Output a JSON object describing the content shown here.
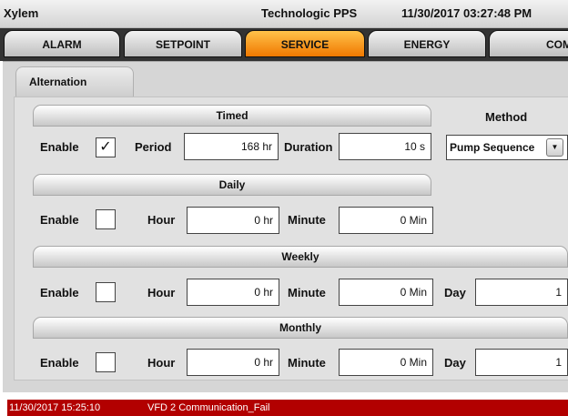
{
  "titlebar": {
    "brand": "Xylem",
    "app_name": "Technologic PPS",
    "datetime": "11/30/2017 03:27:48 PM"
  },
  "tabs": [
    {
      "label": "ALARM",
      "active": false
    },
    {
      "label": "SETPOINT",
      "active": false
    },
    {
      "label": "SERVICE",
      "active": true
    },
    {
      "label": "ENERGY",
      "active": false
    },
    {
      "label": "COM",
      "active": false
    }
  ],
  "subtab": {
    "label": "Alternation"
  },
  "timed": {
    "title": "Timed",
    "enable_label": "Enable",
    "enabled": true,
    "period_label": "Period",
    "period_value": "168 hr",
    "duration_label": "Duration",
    "duration_value": "10 s"
  },
  "method": {
    "title": "Method",
    "value": "Pump Sequence"
  },
  "daily": {
    "title": "Daily",
    "enable_label": "Enable",
    "enabled": false,
    "hour_label": "Hour",
    "hour_value": "0 hr",
    "minute_label": "Minute",
    "minute_value": "0 Min"
  },
  "weekly": {
    "title": "Weekly",
    "enable_label": "Enable",
    "enabled": false,
    "hour_label": "Hour",
    "hour_value": "0 hr",
    "minute_label": "Minute",
    "minute_value": "0 Min",
    "day_label": "Day",
    "day_value": "1"
  },
  "monthly": {
    "title": "Monthly",
    "enable_label": "Enable",
    "enabled": false,
    "hour_label": "Hour",
    "hour_value": "0 hr",
    "minute_label": "Minute",
    "minute_value": "0 Min",
    "day_label": "Day",
    "day_value": "1"
  },
  "status": {
    "timestamp": "11/30/2017 15:25:10",
    "message": "VFD 2 Communication_Fail"
  },
  "icons": {
    "check": "checkmark-icon",
    "dropdown": "dropdown-arrow-icon"
  },
  "colors": {
    "active_tab": "#f07800",
    "alarm_bar": "#b20000"
  }
}
